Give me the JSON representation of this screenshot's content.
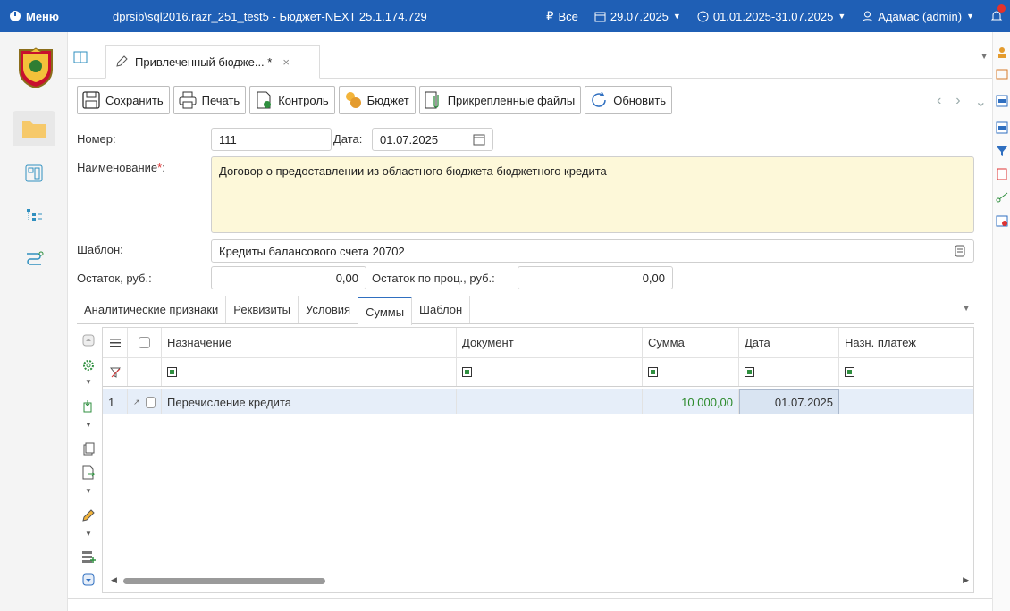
{
  "topbar": {
    "menu_label": "Меню",
    "app_title": "dprsib\\sql2016.razr_251_test5 - Бюджет-NEXT 25.1.174.729",
    "budget_filter": "Все",
    "current_date": "29.07.2025",
    "period": "01.01.2025-31.07.2025",
    "user": "Адамас (admin)"
  },
  "tabs": {
    "doc_tab_title": "Привлеченный бюдже... *",
    "close_glyph": "×"
  },
  "toolbar": {
    "save": "Сохранить",
    "print": "Печать",
    "control": "Контроль",
    "budget": "Бюджет",
    "attached_files": "Прикрепленные файлы",
    "refresh": "Обновить"
  },
  "form": {
    "number_label": "Номер:",
    "number_value": "111",
    "date_label": "Дата:",
    "date_value": "01.07.2025",
    "name_label": "Наименование",
    "required_mark": "*",
    "name_colon": ":",
    "name_value": "Договор о предоставлении из областного бюджета бюджетного кредита",
    "template_label": "Шаблон:",
    "template_value": "Кредиты балансового счета 20702",
    "balance_label": "Остаток, руб.:",
    "balance_value": "0,00",
    "interest_balance_label": "Остаток по проц., руб.:",
    "interest_balance_value": "0,00"
  },
  "inner_tabs": [
    "Аналитические признаки",
    "Реквизиты",
    "Условия",
    "Суммы",
    "Шаблон"
  ],
  "inner_tabs_active": "Суммы",
  "grid": {
    "columns": {
      "purpose": "Назначение",
      "document": "Документ",
      "sum": "Сумма",
      "date": "Дата",
      "payment_purpose": "Назн. платеж"
    },
    "rows": [
      {
        "num": "1",
        "purpose": "Перечисление кредита",
        "document": "",
        "sum": "10 000,00",
        "date": "01.07.2025",
        "payment_purpose": ""
      }
    ]
  },
  "colors": {
    "topbar_bg": "#1f5fb5",
    "required": "#d33333",
    "name_field_bg": "#fdf8d9",
    "sum_green": "#2b8a2b",
    "selected_row": "#e6eef9"
  }
}
